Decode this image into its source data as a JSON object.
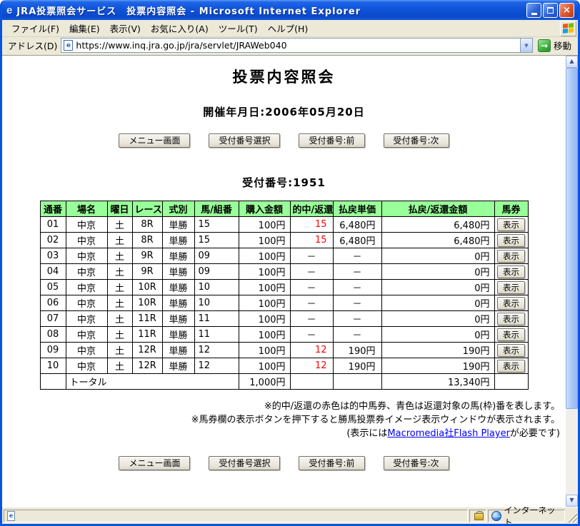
{
  "colors": {
    "header_green": "#99ff99",
    "hit_red": "#ff0000",
    "link_blue": "#0000ff"
  },
  "icons": {
    "ie_logo": "e",
    "page": "e",
    "close": "×",
    "dropdown_arrow": "▼",
    "go_arrow": "→",
    "scroll_up": "▲",
    "scroll_down": "▼"
  },
  "window": {
    "title": "JRA投票照会サービス　投票内容照会 - Microsoft Internet Explorer"
  },
  "menubar": {
    "items": [
      "ファイル(F)",
      "編集(E)",
      "表示(V)",
      "お気に入り(A)",
      "ツール(T)",
      "ヘルプ(H)"
    ]
  },
  "addressbar": {
    "label": "アドレス(D)",
    "url": "https://www.inq.jra.go.jp/jra/servlet/JRAWeb040",
    "go_label": "移動"
  },
  "page": {
    "title": "投票内容照会",
    "event_date": "開催年月日:2006年05月20日",
    "nav_buttons": [
      "メニュー画面",
      "受付番号選択",
      "受付番号:前",
      "受付番号:次"
    ],
    "receipt_number": "受付番号:1951",
    "table": {
      "headers": [
        "通番",
        "場名",
        "曜日",
        "レース",
        "式別",
        "馬/組番",
        "購入金額",
        "的中/返還",
        "払戻単価",
        "払戻/返還金額",
        "馬券"
      ],
      "ticket_button_label": "表示",
      "rows": [
        {
          "no": "01",
          "place": "中京",
          "day": "土",
          "race": "8R",
          "bet_type": "単勝",
          "number": "15",
          "amount": "100円",
          "hit": "15",
          "hit_red": true,
          "unit_payout": "6,480円",
          "payout": "6,480円"
        },
        {
          "no": "02",
          "place": "中京",
          "day": "土",
          "race": "8R",
          "bet_type": "単勝",
          "number": "15",
          "amount": "100円",
          "hit": "15",
          "hit_red": true,
          "unit_payout": "6,480円",
          "payout": "6,480円"
        },
        {
          "no": "03",
          "place": "中京",
          "day": "土",
          "race": "9R",
          "bet_type": "単勝",
          "number": "09",
          "amount": "100円",
          "hit": "－",
          "hit_red": false,
          "unit_payout": "－",
          "payout": "0円"
        },
        {
          "no": "04",
          "place": "中京",
          "day": "土",
          "race": "9R",
          "bet_type": "単勝",
          "number": "09",
          "amount": "100円",
          "hit": "－",
          "hit_red": false,
          "unit_payout": "－",
          "payout": "0円"
        },
        {
          "no": "05",
          "place": "中京",
          "day": "土",
          "race": "10R",
          "bet_type": "単勝",
          "number": "10",
          "amount": "100円",
          "hit": "－",
          "hit_red": false,
          "unit_payout": "－",
          "payout": "0円"
        },
        {
          "no": "06",
          "place": "中京",
          "day": "土",
          "race": "10R",
          "bet_type": "単勝",
          "number": "10",
          "amount": "100円",
          "hit": "－",
          "hit_red": false,
          "unit_payout": "－",
          "payout": "0円"
        },
        {
          "no": "07",
          "place": "中京",
          "day": "土",
          "race": "11R",
          "bet_type": "単勝",
          "number": "11",
          "amount": "100円",
          "hit": "－",
          "hit_red": false,
          "unit_payout": "－",
          "payout": "0円"
        },
        {
          "no": "08",
          "place": "中京",
          "day": "土",
          "race": "11R",
          "bet_type": "単勝",
          "number": "11",
          "amount": "100円",
          "hit": "－",
          "hit_red": false,
          "unit_payout": "－",
          "payout": "0円"
        },
        {
          "no": "09",
          "place": "中京",
          "day": "土",
          "race": "12R",
          "bet_type": "単勝",
          "number": "12",
          "amount": "100円",
          "hit": "12",
          "hit_red": true,
          "unit_payout": "190円",
          "payout": "190円"
        },
        {
          "no": "10",
          "place": "中京",
          "day": "土",
          "race": "12R",
          "bet_type": "単勝",
          "number": "12",
          "amount": "100円",
          "hit": "12",
          "hit_red": true,
          "unit_payout": "190円",
          "payout": "190円"
        }
      ],
      "total": {
        "label": "トータル",
        "amount": "1,000円",
        "payout": "13,340円"
      }
    },
    "notes": {
      "line1": "※的中/返還の赤色は的中馬券、青色は返還対象の馬(枠)番を表します。",
      "line2": "※馬券欄の表示ボタンを押下すると勝馬投票券イメージ表示ウィンドウが表示されます。",
      "line3_prefix": "(表示には",
      "line3_link": "Macromedia社Flash Player",
      "line3_suffix": "が必要です)"
    }
  },
  "statusbar": {
    "zone": "インターネット"
  }
}
